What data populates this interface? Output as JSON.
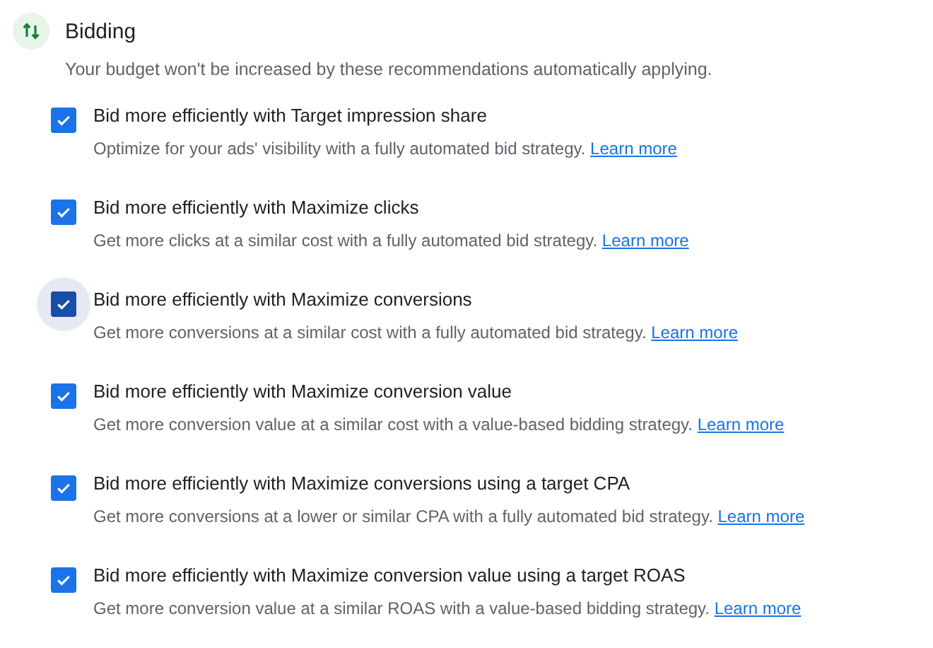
{
  "section": {
    "title": "Bidding",
    "subtitle": "Your budget won't be increased by these recommendations automatically applying."
  },
  "items": [
    {
      "label": "Bid more efficiently with Target impression share",
      "description": "Optimize for your ads' visibility with a fully automated bid strategy.",
      "link": "Learn more",
      "checked": true,
      "focused": false
    },
    {
      "label": "Bid more efficiently with Maximize clicks",
      "description": "Get more clicks at a similar cost with a fully automated bid strategy.",
      "link": "Learn more",
      "checked": true,
      "focused": false
    },
    {
      "label": "Bid more efficiently with Maximize conversions",
      "description": "Get more conversions at a similar cost with a fully automated bid strategy.",
      "link": "Learn more",
      "checked": true,
      "focused": true
    },
    {
      "label": "Bid more efficiently with Maximize conversion value",
      "description": "Get more conversion value at a similar cost with a value-based bidding strategy.",
      "link": "Learn more",
      "checked": true,
      "focused": false
    },
    {
      "label": "Bid more efficiently with Maximize conversions using a target CPA",
      "description": "Get more conversions at a lower or similar CPA with a fully automated bid strategy.",
      "link": "Learn more",
      "checked": true,
      "focused": false
    },
    {
      "label": "Bid more efficiently with Maximize conversion value using a target ROAS",
      "description": "Get more conversion value at a similar ROAS with a value-based bidding strategy.",
      "link": "Learn more",
      "checked": true,
      "focused": false
    }
  ]
}
